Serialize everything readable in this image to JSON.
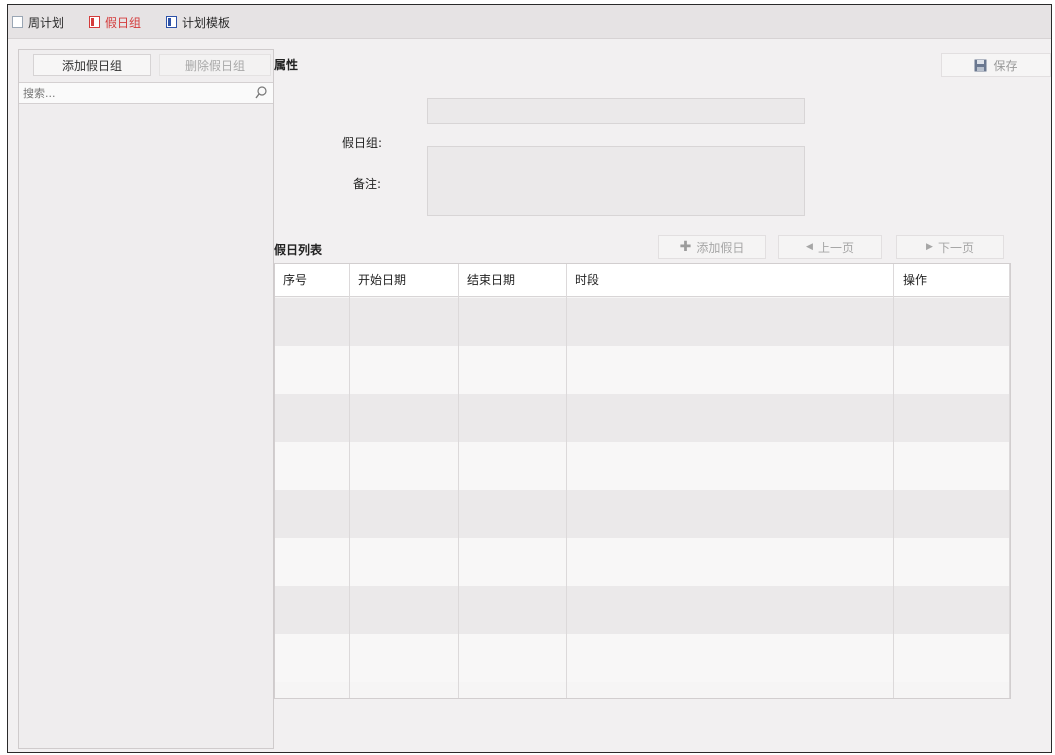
{
  "tabs": [
    {
      "label": "周计划",
      "icon": "calendar-icon",
      "state": "normal"
    },
    {
      "label": "假日组",
      "icon": "holiday-group-icon",
      "state": "active"
    },
    {
      "label": "计划模板",
      "icon": "template-icon",
      "state": "normal"
    }
  ],
  "left": {
    "add_button": "添加假日组",
    "delete_button": "删除假日组",
    "search_placeholder": "搜索..."
  },
  "props": {
    "title": "属性",
    "save_label": "保存",
    "group_label": "假日组:",
    "group_value": "",
    "note_label": "备注:",
    "note_value": ""
  },
  "holiday_list": {
    "title": "假日列表",
    "add_button": "添加假日",
    "prev_button": "上一页",
    "next_button": "下一页",
    "columns": [
      "序号",
      "开始日期",
      "结束日期",
      "时段",
      "操作"
    ],
    "rows": []
  },
  "colors": {
    "active_tab": "#d43b3b",
    "template_icon": "#2d52a8",
    "disabled_text": "#a6a6a6"
  }
}
